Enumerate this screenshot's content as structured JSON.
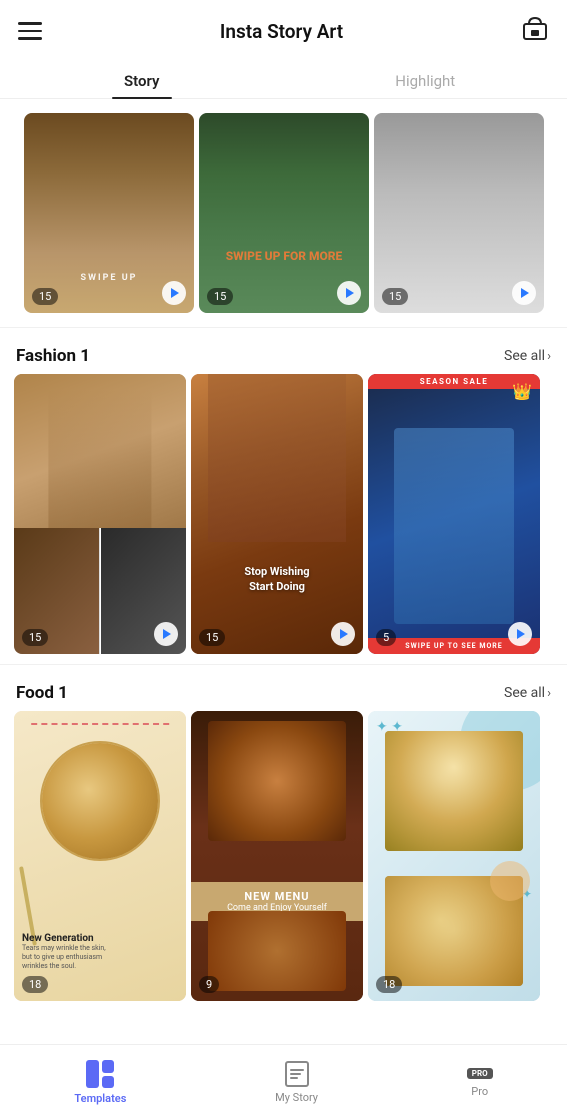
{
  "header": {
    "title": "Insta Story Art",
    "menu_icon": "≡",
    "store_icon": "🏪"
  },
  "tabs": [
    {
      "label": "Story",
      "active": true
    },
    {
      "label": "Highlight",
      "active": false
    }
  ],
  "top_section": {
    "cards": [
      {
        "count": "15",
        "has_play": true
      },
      {
        "count": "15",
        "has_play": true,
        "swipe_text": "SWIPE UP FOR MORE"
      },
      {
        "count": "15",
        "has_play": true
      }
    ]
  },
  "sections": [
    {
      "id": "fashion1",
      "title": "Fashion 1",
      "see_all": "See all",
      "cards": [
        {
          "count": "15",
          "has_play": true,
          "type": "collage"
        },
        {
          "count": "15",
          "has_play": true,
          "type": "building",
          "overlay_text": "Stop Wishing\nStart Doing"
        },
        {
          "count": "5",
          "has_play": true,
          "type": "red-season",
          "has_crown": true,
          "season_text": "SEASON SALE",
          "swipe_text": "SWIPE UP TO SEE MORE"
        }
      ]
    },
    {
      "id": "food1",
      "title": "Food 1",
      "see_all": "See all",
      "cards": [
        {
          "count": "18",
          "has_play": false,
          "type": "food-light",
          "gen_title": "New Generation",
          "gen_body": "Tears may wrinkle the skin, but to give up enthusiasm wrinkles the soul."
        },
        {
          "count": "9",
          "has_play": false,
          "type": "food-dark",
          "menu_title": "NEW MENU",
          "menu_sub": "Come and Enjoy Yourself"
        },
        {
          "count": "18",
          "has_play": false,
          "type": "food-light2"
        }
      ]
    }
  ],
  "bottom_nav": {
    "items": [
      {
        "id": "templates",
        "label": "Templates",
        "active": true,
        "icon_type": "grid"
      },
      {
        "id": "mystory",
        "label": "My Story",
        "active": false,
        "icon_type": "doc"
      },
      {
        "id": "pro",
        "label": "Pro",
        "active": false,
        "icon_type": "pro",
        "badge": "PRO"
      }
    ]
  }
}
